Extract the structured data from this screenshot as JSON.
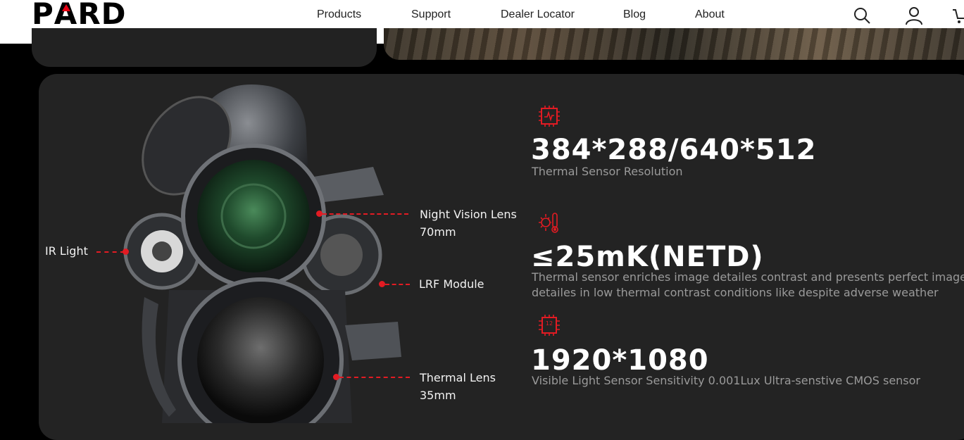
{
  "header": {
    "logo": {
      "left": "P",
      "mark": "A",
      "right": "RD"
    },
    "nav": [
      {
        "label": "Products"
      },
      {
        "label": "Support"
      },
      {
        "label": "Dealer Locator"
      },
      {
        "label": "Blog"
      },
      {
        "label": "About"
      }
    ],
    "icons": [
      "search-icon",
      "user-icon",
      "cart-icon"
    ]
  },
  "colors": {
    "accent": "#e31b23",
    "card": "#232323",
    "background": "#000000"
  },
  "callouts": {
    "ir_light": "IR Light",
    "night_vision_lens_1": "Night  Vision Lens",
    "night_vision_lens_2": "70mm",
    "lrf_module": "LRF Module",
    "thermal_lens_1": "Thermal Lens",
    "thermal_lens_2": "35mm"
  },
  "specs": [
    {
      "icon": "chip-icon",
      "value": "384*288/640*512",
      "label": "Thermal Sensor Resolution"
    },
    {
      "icon": "thermometer-icon",
      "value": "≤25mK(NETD)",
      "label_1": "Thermal sensor enriches image detailes contrast and presents perfect image",
      "label_2": "detailes in low thermal contrast conditions like despite adverse weather"
    },
    {
      "icon": "sensor-chip-icon",
      "value": "1920*1080",
      "label": "Visible Light Sensor Sensitivity 0.001Lux Ultra-senstive CMOS sensor"
    }
  ]
}
